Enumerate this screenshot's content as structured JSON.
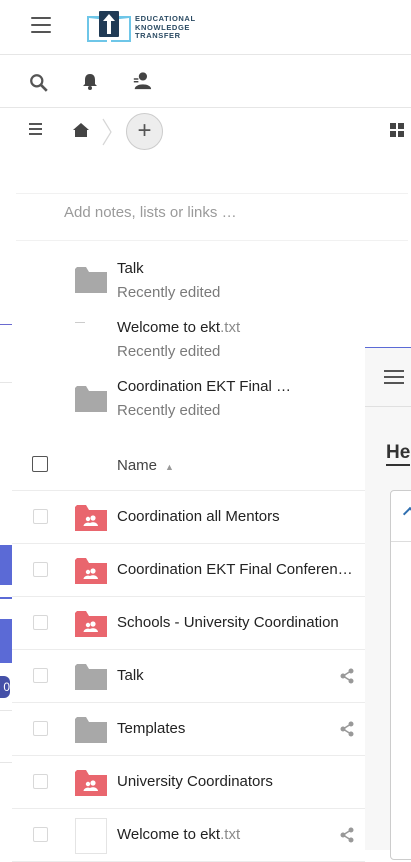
{
  "header": {
    "logo_lines": [
      "EDUCATIONAL",
      "KNOWLEDGE",
      "TRANSFER"
    ]
  },
  "new_note": {
    "placeholder": "Add notes, lists or links …"
  },
  "recent": [
    {
      "title": "Talk",
      "subtitle": "Recently edited",
      "icon": "folder-icon"
    },
    {
      "title_name": "Welcome to ekt",
      "title_ext": ".txt",
      "subtitle": "Recently edited",
      "icon": "text-file-icon"
    },
    {
      "title": "Coordination EKT Final …",
      "subtitle": "Recently edited",
      "icon": "folder-icon"
    }
  ],
  "table": {
    "name_header": "Name",
    "rows": [
      {
        "name": "Coordination all Mentors",
        "ext": "",
        "icon": "group-folder-icon",
        "shared": false
      },
      {
        "name": "Coordination EKT Final Conferen…",
        "ext": "",
        "icon": "group-folder-icon",
        "shared": false
      },
      {
        "name": "Schools - University Coordination",
        "ext": "",
        "icon": "group-folder-icon",
        "shared": false
      },
      {
        "name": "Talk",
        "ext": "",
        "icon": "folder-icon",
        "shared": true
      },
      {
        "name": "Templates",
        "ext": "",
        "icon": "folder-icon",
        "shared": true
      },
      {
        "name": "University Coordinators",
        "ext": "",
        "icon": "group-folder-icon",
        "shared": false
      },
      {
        "name": "Welcome to ekt",
        "ext": ".txt",
        "icon": "text-file-icon",
        "shared": true
      }
    ]
  },
  "background": {
    "heading_fragment": "He",
    "badge": "0"
  },
  "colors": {
    "group_folder": "#e9666e",
    "folder": "#a8a8a8",
    "accent": "#5b6ad6"
  }
}
